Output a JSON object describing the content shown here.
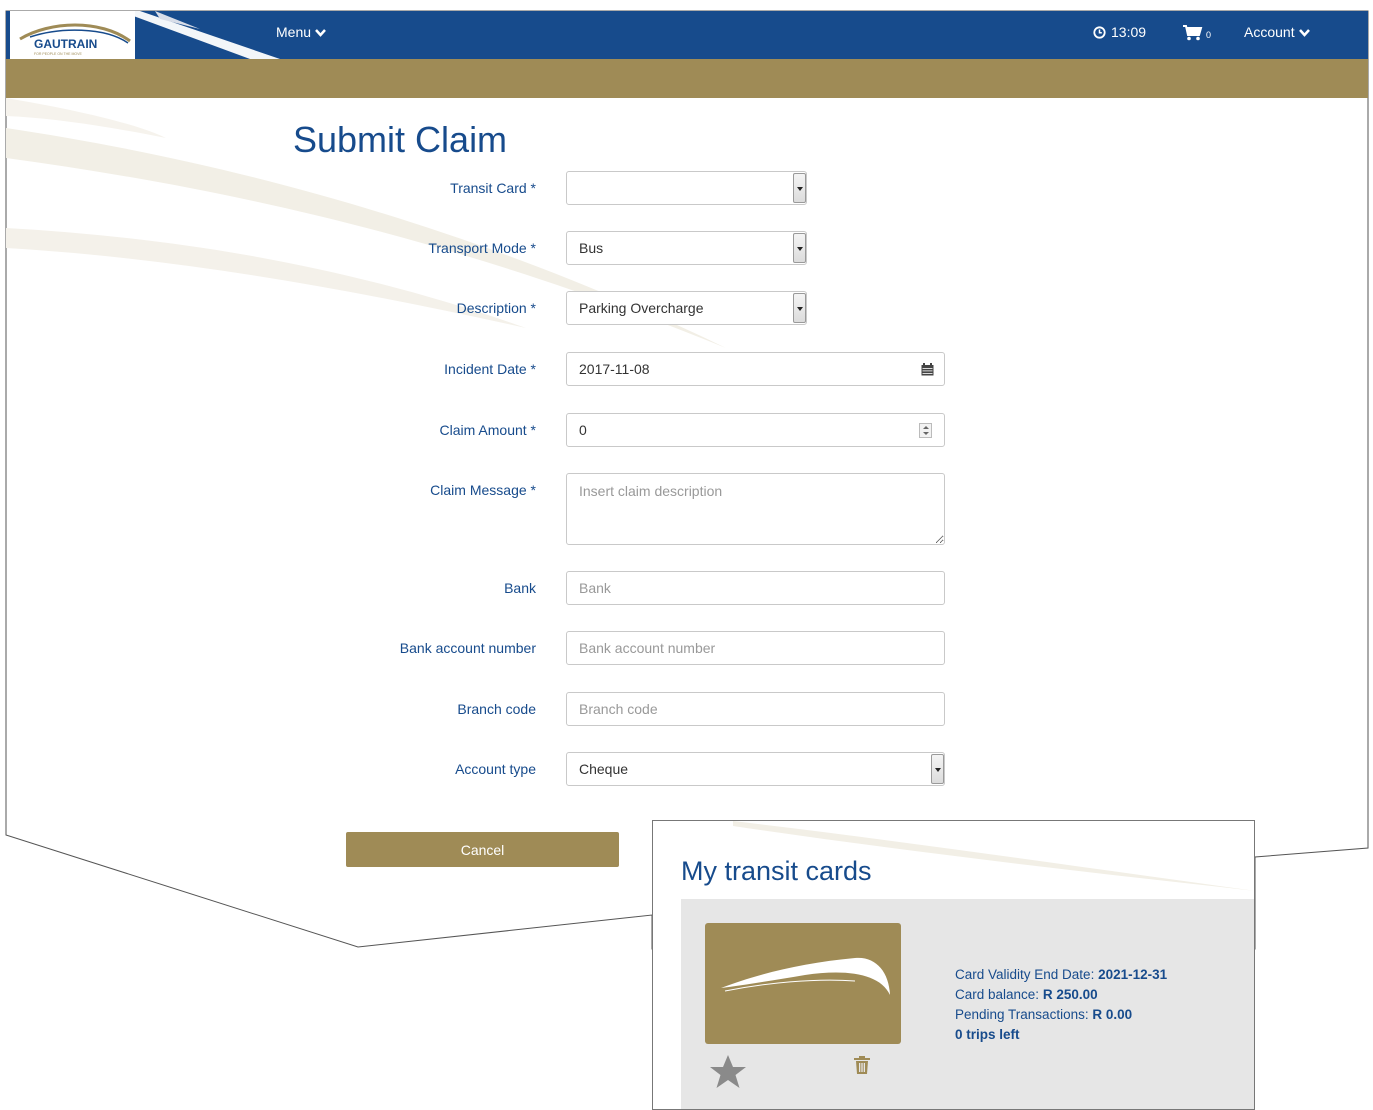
{
  "header": {
    "brand": "GAUTRAIN",
    "tagline": "FOR PEOPLE ON THE MOVE",
    "menu_label": "Menu",
    "time": "13:09",
    "cart_count": "0",
    "account_label": "Account"
  },
  "page": {
    "title": "Submit Claim"
  },
  "form": {
    "transit_card": {
      "label": "Transit Card *",
      "value": ""
    },
    "transport_mode": {
      "label": "Transport Mode *",
      "value": "Bus"
    },
    "description": {
      "label": "Description *",
      "value": "Parking Overcharge"
    },
    "incident_date": {
      "label": "Incident Date *",
      "value": "2017-11-08"
    },
    "claim_amount": {
      "label": "Claim Amount *",
      "value": "0"
    },
    "claim_message": {
      "label": "Claim Message *",
      "placeholder": "Insert claim description"
    },
    "bank": {
      "label": "Bank",
      "placeholder": "Bank"
    },
    "bank_account": {
      "label": "Bank account number",
      "placeholder": "Bank account number"
    },
    "branch_code": {
      "label": "Branch code",
      "placeholder": "Branch code"
    },
    "account_type": {
      "label": "Account type",
      "value": "Cheque"
    },
    "cancel_label": "Cancel"
  },
  "transit_cards": {
    "title": "My transit cards",
    "card": {
      "validity_label": "Card Validity End Date:",
      "validity_value": "2021-12-31",
      "balance_label": "Card balance:",
      "balance_value": "R 250.00",
      "pending_label": "Pending Transactions:",
      "pending_value": "R 0.00",
      "trips": "0 trips left"
    }
  },
  "colors": {
    "brand_blue": "#174b8c",
    "brand_gold": "#9f8b56"
  },
  "icons": [
    "logo",
    "chevron-down-icon",
    "clock-icon",
    "cart-icon",
    "calendar-icon",
    "spinner-icon",
    "star-icon",
    "trash-icon"
  ]
}
